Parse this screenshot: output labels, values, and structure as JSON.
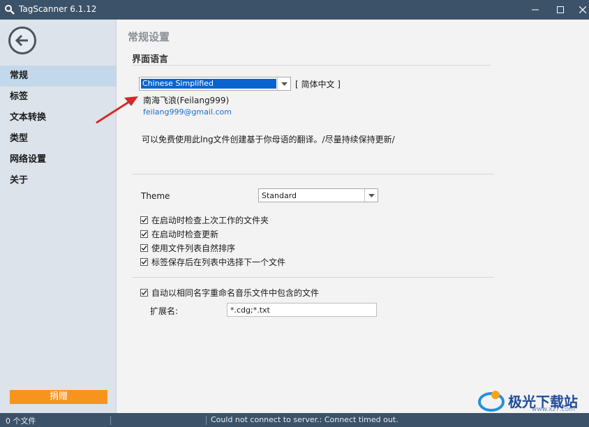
{
  "window": {
    "title": "TagScanner 6.1.12"
  },
  "sidebar": {
    "items": [
      {
        "label": "常规",
        "active": true
      },
      {
        "label": "标签"
      },
      {
        "label": "文本转换"
      },
      {
        "label": "类型"
      },
      {
        "label": "网络设置"
      },
      {
        "label": "关于"
      }
    ],
    "donate_label": "捐赠"
  },
  "content": {
    "page_title": "常规设置",
    "language_section": "界面语言",
    "language_value": "Chinese Simplified",
    "language_native": "[ 简体中文 ]",
    "author": "南海飞浪(Feilang999)",
    "email": "feilang999@gmail.com",
    "note": "可以免费使用此lng文件创建基于你母语的翻译。/尽量持续保持更新/",
    "theme_label": "Theme",
    "theme_value": "Standard",
    "checkboxes": [
      {
        "label": "在启动时检查上次工作的文件夹",
        "checked": true
      },
      {
        "label": "在启动时检查更新",
        "checked": true
      },
      {
        "label": "使用文件列表自然排序",
        "checked": true
      },
      {
        "label": "标签保存后在列表中选择下一个文件",
        "checked": true
      },
      {
        "label": "自动以相同名字重命名音乐文件中包含的文件",
        "checked": true
      }
    ],
    "ext_label": "扩展名:",
    "ext_value": "*.cdg;*.txt"
  },
  "status": {
    "file_count": "0 个文件",
    "message": "Could not connect to server.: Connect timed out."
  },
  "watermark": {
    "text": "极光下载站",
    "url": "www.xz7.com"
  },
  "colors": {
    "titlebar": "#3c5268",
    "sidebar": "#dce3ea",
    "active_item": "#c3d8ea",
    "donate": "#f7941d",
    "selection": "#0a64d0",
    "annotation_arrow": "#d42a2a"
  }
}
